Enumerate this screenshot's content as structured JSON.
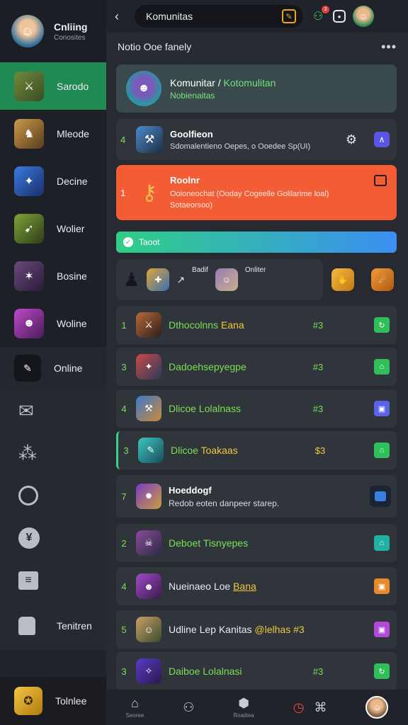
{
  "sidebar": {
    "header": {
      "title": "Cnliing",
      "subtitle": "Conosites"
    },
    "items": [
      {
        "label": "Sarodo",
        "active": true,
        "color": "#1f8a52"
      },
      {
        "label": "Mleode"
      },
      {
        "label": "Decine"
      },
      {
        "label": "Wolier"
      },
      {
        "label": "Bosine"
      },
      {
        "label": "Woline"
      },
      {
        "label": "Online"
      }
    ],
    "icon_items": [
      {
        "icon": "mail-icon"
      },
      {
        "icon": "community-icon"
      },
      {
        "icon": "profile-icon"
      },
      {
        "icon": "yen-icon"
      },
      {
        "icon": "list-icon"
      },
      {
        "label": "Tenitren",
        "icon": "user-icon"
      }
    ],
    "footer": {
      "label": "Tolnlee"
    }
  },
  "topbar": {
    "search_value": "Komunitas",
    "notification_count": "3"
  },
  "section": {
    "title": "Notio Ooe fanely",
    "more": "•••"
  },
  "community_card": {
    "title": "Komunitar",
    "title_green": "Kotomulitan",
    "subtitle": "Nobienaitas"
  },
  "pinned_card": {
    "rank": "4",
    "title": "Goolfieon",
    "subtitle": "Sdomalentieno Oepes, o Ooedee Sp(UI)"
  },
  "hot_card": {
    "rank": "1",
    "title": "Roolnr",
    "subtitle": "Ooioneochat (Ooday Cogeelle Golilarime loal) Sotaeorsoo)",
    "color": "#f25d36"
  },
  "banner": {
    "label": "Taoot"
  },
  "strip": {
    "label_a": "Badif",
    "label_b": "Onliter"
  },
  "rows": [
    {
      "rank": "1",
      "name": "Dthocolnns",
      "name_tail": "Eana",
      "count": "#3",
      "action_color": "#2fbf5a"
    },
    {
      "rank": "3",
      "name": "Dadoehsepyegpe",
      "name_tail": "",
      "count": "#3",
      "action_color": "#2fbf5a"
    },
    {
      "rank": "4",
      "name": "Dlicoe Lolalnass",
      "name_tail": "",
      "count": "#3",
      "action_color": "#5b63e6"
    },
    {
      "rank": "3",
      "name": "Dlicoe",
      "name_tail": "Toakaas",
      "count": "$3",
      "action_color": "#2fbf5a"
    },
    {
      "rank": "2",
      "name": "Deboet Tisnyepes",
      "name_tail": "",
      "count": "",
      "action_color": "#22b0a5"
    },
    {
      "rank": "4",
      "name": "Nueinaeo Loe",
      "name_tail": "Bana",
      "count": "",
      "action_color": "#e88a2a"
    },
    {
      "rank": "5",
      "name": "Udline Lep Kanitas",
      "name_tail": "@lelhas #3",
      "count": "",
      "action_color": "#b14ad8"
    },
    {
      "rank": "3",
      "name": "Daiboe Lolalnasi",
      "name_tail": "",
      "count": "#3",
      "action_color": "#2fbf5a"
    }
  ],
  "detail_row": {
    "rank": "7",
    "title": "Hoeddogf",
    "subtitle": "Redob eoten danpeer starep."
  },
  "bottom_nav": {
    "home": "Seoree",
    "shop": "Roaiitea"
  }
}
